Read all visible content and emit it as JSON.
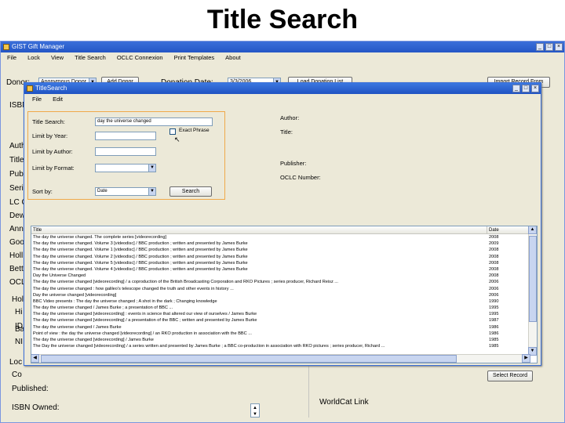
{
  "slide": {
    "title": "Title Search"
  },
  "main_window": {
    "title": "GIST Gift Manager",
    "menu": [
      "File",
      "Lock",
      "View",
      "Title Search",
      "OCLC Connexion",
      "Print Templates",
      "About"
    ],
    "donor_label": "Donor:",
    "donor_value": "Anonymous Donor",
    "donor_button": "Add Donor",
    "donation_date_label": "Donation Date:",
    "donation_date_value": "3/3/2006",
    "donation_button": "Load Donation List",
    "import_button": "Import Record From Clipbo",
    "left_labels": [
      "ISBN",
      "Auth",
      "Title",
      "Publ",
      "Seri",
      "LC C",
      "Dew",
      "Ann",
      "Goo",
      "Holl",
      "Bett",
      "OCL",
      "Hol",
      "Hi",
      "ID",
      "Bar",
      "NI",
      "Loc",
      "Co"
    ],
    "published_label": "Published:",
    "isbn_owned_label": "ISBN Owned:",
    "worldcat_label": "WorldCat Link",
    "select_record_button": "Select Record"
  },
  "dialog": {
    "title": "TitleSearch",
    "menu": [
      "File",
      "Edit"
    ],
    "title_search_label": "Title Search:",
    "title_search_value": "day the universe changed",
    "limit_year_label": "Limit by Year:",
    "exact_phrase_label": "Exact Phrase",
    "limit_author_label": "Limit by Author:",
    "limit_format_label": "Limit by Format:",
    "sort_label": "Sort by:",
    "sort_value": "Date",
    "search_button": "Search",
    "author_label": "Author:",
    "title_label": "Title:",
    "publisher_label": "Publisher:",
    "oclc_label": "OCLC Number:",
    "results": {
      "columns": [
        "Title",
        "Date"
      ],
      "rows": [
        {
          "title": "The day the universe changed. The complete series [videorecording]",
          "date": "2008"
        },
        {
          "title": "The day the universe changed. Volume 3 [videodisc] / BBC production ; written and presented by James Burke",
          "date": "2009"
        },
        {
          "title": "The day the universe changed. Volume 1 [videodisc] / BBC production ; written and presented by James Burke",
          "date": "2008"
        },
        {
          "title": "The day the universe changed. Volume 2 [videodisc] / BBC production ; written and presented by James Burke",
          "date": "2008"
        },
        {
          "title": "The day the universe changed. Volume 5 [videodisc] / BBC production ; written and presented by James Burke",
          "date": "2008"
        },
        {
          "title": "The day the universe changed. Volume 4 [videodisc] / BBC production ; written and presented by James Burke",
          "date": "2008"
        },
        {
          "title": "Day the Universe Changed",
          "date": "2008"
        },
        {
          "title": "The day the universe changed [videorecording] / a coproduction of the British Broadcasting Corporation and RKO Pictures ; series producer, Richard Reisz ...",
          "date": "2006"
        },
        {
          "title": "The day the universe changed : how galileo's telescope changed the truth and other events in history ...",
          "date": "2006"
        },
        {
          "title": "Day the universe changed [videorecording]",
          "date": "2006"
        },
        {
          "title": "BBC Video presents : The day the universe changed ; A shot in the dark ; Changing knowledge",
          "date": "1990"
        },
        {
          "title": "The day the universe changed / James Burke ; a presentation of BBC ...",
          "date": "1995"
        },
        {
          "title": "The day the universe changed [videorecording] : events in science that altered our view of ourselves / James Burke",
          "date": "1995"
        },
        {
          "title": "The day the universe changed [videorecording] / a presentation of the BBC ; written and presented by James Burke",
          "date": "1987"
        },
        {
          "title": "The day the universe changed / James Burke",
          "date": "1986"
        },
        {
          "title": "Point of view : the day the universe changed [videorecording] / an RKO production in association with the BBC ...",
          "date": "1986"
        },
        {
          "title": "The day the universe changed [videorecording] / James Burke",
          "date": "1985"
        },
        {
          "title": "The Day the universe changed [videorecording] / a series written and presented by James Burke ; a BBC co-production in association with RKO pictures ; series producer, Richard ...",
          "date": "1985"
        }
      ]
    }
  }
}
